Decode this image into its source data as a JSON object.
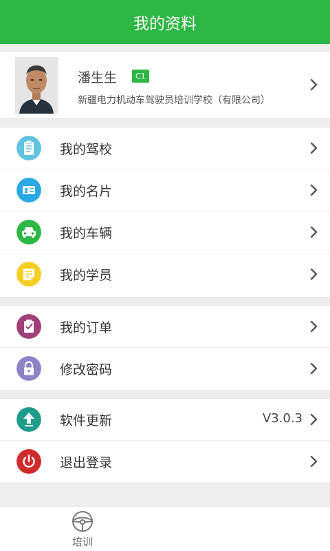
{
  "header": {
    "title": "我的资料"
  },
  "profile": {
    "name": "潘生生",
    "badge": "C1",
    "org": "新疆电力机动车驾驶员培训学校（有限公司）"
  },
  "groups": [
    {
      "items": [
        {
          "label": "我的驾校",
          "icon": "clipboard-icon",
          "color": "#62c3e0"
        },
        {
          "label": "我的名片",
          "icon": "card-icon",
          "color": "#2aa8e6"
        },
        {
          "label": "我的车辆",
          "icon": "car-icon",
          "color": "#2db744"
        },
        {
          "label": "我的学员",
          "icon": "note-icon",
          "color": "#f4cf22"
        }
      ]
    },
    {
      "items": [
        {
          "label": "我的订单",
          "icon": "order-icon",
          "color": "#a03f78"
        },
        {
          "label": "修改密码",
          "icon": "lock-icon",
          "color": "#8d84c7"
        }
      ]
    },
    {
      "items": [
        {
          "label": "软件更新",
          "icon": "upload-icon",
          "color": "#1f9b8a",
          "value": "V3.0.3"
        },
        {
          "label": "退出登录",
          "icon": "power-icon",
          "color": "#d02b2b"
        }
      ]
    }
  ],
  "tabbar": {
    "tabs": [
      {
        "label": "培训",
        "icon": "steering-wheel-icon"
      }
    ]
  }
}
